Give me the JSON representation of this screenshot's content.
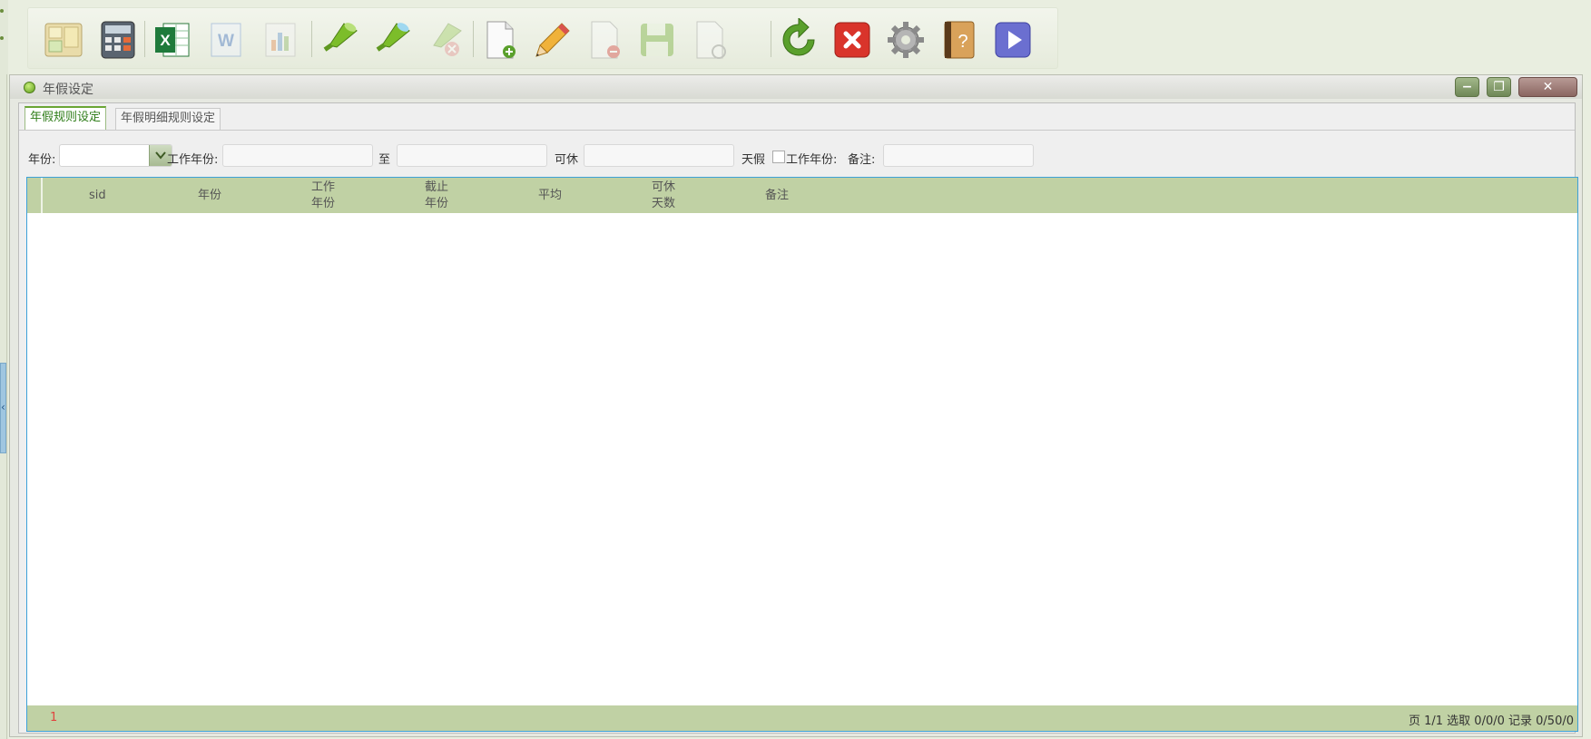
{
  "window": {
    "title": "年假设定"
  },
  "tabs": [
    {
      "label": "年假规则设定",
      "active": true
    },
    {
      "label": "年假明细规则设定",
      "active": false
    }
  ],
  "filter": {
    "year_label": "年份:",
    "year_value": "",
    "work_years_label": "工作年份:",
    "to_label": "至",
    "rest_label": "可休",
    "days_off_label": "天假",
    "work_years_check_label": "工作年份:",
    "remark_label": "备注:"
  },
  "grid": {
    "columns": [
      {
        "lines": [
          "sid"
        ]
      },
      {
        "lines": [
          "年份"
        ]
      },
      {
        "lines": [
          "工作",
          "年份"
        ]
      },
      {
        "lines": [
          "截止",
          "年份"
        ]
      },
      {
        "lines": [
          "平均"
        ]
      },
      {
        "lines": [
          "可休",
          "天数"
        ]
      },
      {
        "lines": [
          "备注"
        ]
      }
    ],
    "rows": [],
    "page_number": "1",
    "status_text": "页 1/1 选取 0/0/0 记录 0/50/0"
  },
  "toolbar": {
    "buttons": [
      {
        "icon": "notes-icon",
        "enabled": true
      },
      {
        "icon": "calculator-icon",
        "enabled": true
      },
      {
        "icon": "excel-export-icon",
        "enabled": true
      },
      {
        "icon": "word-export-icon",
        "enabled": false
      },
      {
        "icon": "chart-icon",
        "enabled": false
      },
      {
        "icon": "filter-icon",
        "enabled": true
      },
      {
        "icon": "advanced-filter-icon",
        "enabled": true
      },
      {
        "icon": "clear-filter-icon",
        "enabled": false
      },
      {
        "icon": "add-document-icon",
        "enabled": true
      },
      {
        "icon": "edit-pencil-icon",
        "enabled": true
      },
      {
        "icon": "delete-document-icon",
        "enabled": false
      },
      {
        "icon": "save-icon",
        "enabled": false
      },
      {
        "icon": "restore-document-icon",
        "enabled": false
      },
      {
        "icon": "refresh-icon",
        "enabled": true
      },
      {
        "icon": "close-red-icon",
        "enabled": true
      },
      {
        "icon": "settings-gear-icon",
        "enabled": true
      },
      {
        "icon": "help-book-icon",
        "enabled": true
      },
      {
        "icon": "play-icon",
        "enabled": true
      }
    ]
  },
  "colors": {
    "accent_green": "#6aa534",
    "grid_header": "#c0d1a4",
    "grid_border": "#3da1d8",
    "page_number_red": "#e0443e"
  }
}
